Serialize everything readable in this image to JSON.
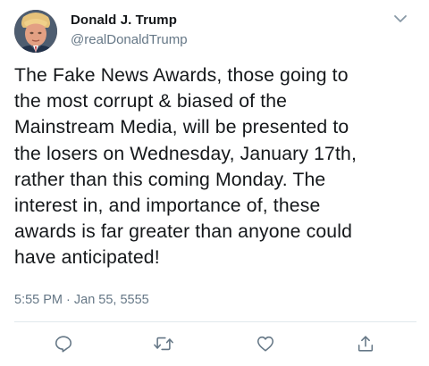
{
  "tweet": {
    "author": {
      "display_name": "Donald J. Trump",
      "handle": "@realDonaldTrump",
      "avatar_icon": "profile-photo"
    },
    "menu_icon": "chevron-down-icon",
    "text": "The Fake News Awards, those going to\nthe most corrupt & biased of the\nMainstream Media, will be presented to\nthe losers on Wednesday, January 17th,\nrather than this coming Monday. The\ninterest in, and importance of, these\nawards is far greater than anyone could\nhave anticipated!",
    "timestamp": "5:55 PM · Jan 55, 5555",
    "actions": [
      {
        "name": "reply",
        "icon": "reply-icon"
      },
      {
        "name": "retweet",
        "icon": "retweet-icon"
      },
      {
        "name": "like",
        "icon": "heart-icon"
      },
      {
        "name": "share",
        "icon": "share-icon"
      }
    ]
  },
  "colors": {
    "text_primary": "#14171a",
    "text_secondary": "#657786",
    "divider": "#e1e8ed",
    "icon": "#657786"
  }
}
